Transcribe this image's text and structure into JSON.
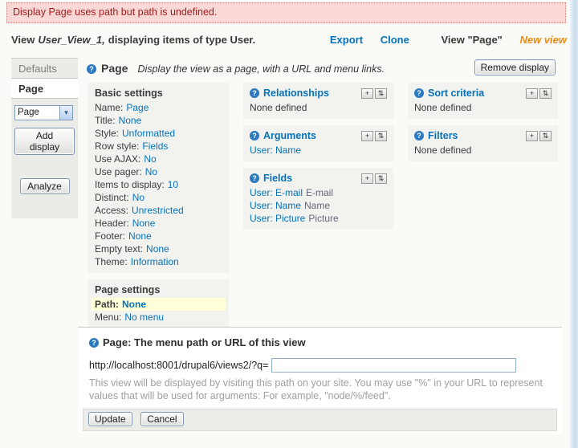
{
  "error": {
    "message": "Display Page uses path but path is undefined."
  },
  "header": {
    "title_prefix": "View",
    "view_name": "User_View_1,",
    "title_suffix": "displaying items of type User.",
    "links": {
      "export": "Export",
      "clone": "Clone",
      "view_page": "View \"Page\"",
      "new_view": "New view"
    }
  },
  "sidebar": {
    "tabs": [
      {
        "label": "Defaults"
      },
      {
        "label": "Page"
      }
    ],
    "display_select": {
      "value": "Page"
    },
    "add_display_label": "Add display",
    "analyze_label": "Analyze"
  },
  "main": {
    "title": "Page",
    "subtitle": "Display the view as a page, with a URL and menu links.",
    "remove_display_label": "Remove display",
    "basic_settings": {
      "title": "Basic settings",
      "items": [
        {
          "label": "Name:",
          "value": "Page"
        },
        {
          "label": "Title:",
          "value": "None"
        },
        {
          "label": "Style:",
          "value": "Unformatted"
        },
        {
          "label": "Row style:",
          "value": "Fields"
        },
        {
          "label": "Use AJAX:",
          "value": "No"
        },
        {
          "label": "Use pager:",
          "value": "No"
        },
        {
          "label": "Items to display:",
          "value": "10"
        },
        {
          "label": "Distinct:",
          "value": "No"
        },
        {
          "label": "Access:",
          "value": "Unrestricted"
        },
        {
          "label": "Header:",
          "value": "None"
        },
        {
          "label": "Footer:",
          "value": "None"
        },
        {
          "label": "Empty text:",
          "value": "None"
        },
        {
          "label": "Theme:",
          "value": "Information"
        }
      ]
    },
    "page_settings": {
      "title": "Page settings",
      "items": [
        {
          "label": "Path:",
          "value": "None"
        },
        {
          "label": "Menu:",
          "value": "No menu"
        }
      ]
    },
    "panels": {
      "relationships": {
        "title": "Relationships",
        "empty": "None defined"
      },
      "arguments": {
        "title": "Arguments",
        "items": [
          {
            "link": "User: Name"
          }
        ]
      },
      "fields": {
        "title": "Fields",
        "items": [
          {
            "link": "User: E-mail",
            "label": "E-mail"
          },
          {
            "link": "User: Name",
            "label": "Name"
          },
          {
            "link": "User: Picture",
            "label": "Picture"
          }
        ]
      },
      "sort": {
        "title": "Sort criteria",
        "empty": "None defined"
      },
      "filters": {
        "title": "Filters",
        "empty": "None defined"
      }
    }
  },
  "config": {
    "heading": "Page: The menu path or URL of this view",
    "url_prefix": "http://localhost:8001/drupal6/views2/?q=",
    "path_input": {
      "value": "",
      "placeholder": ""
    },
    "description": "This view will be displayed by visiting this path on your site. You may use \"%\" in your URL to represent values that will be used for arguments: For example, \"node/%/feed\".",
    "update_label": "Update",
    "cancel_label": "Cancel"
  },
  "icons": {
    "help": "?",
    "add": "+",
    "rearrange": "⇅",
    "select_arrow": "▾"
  },
  "colors": {
    "link_blue": "#0672b9",
    "accent_orange": "#ee8b0c",
    "error_text": "#a21c1c",
    "error_bg": "#f8d7d5",
    "highlight_yellow": "#ffffd9",
    "panel_gray": "#f2f2ee"
  }
}
